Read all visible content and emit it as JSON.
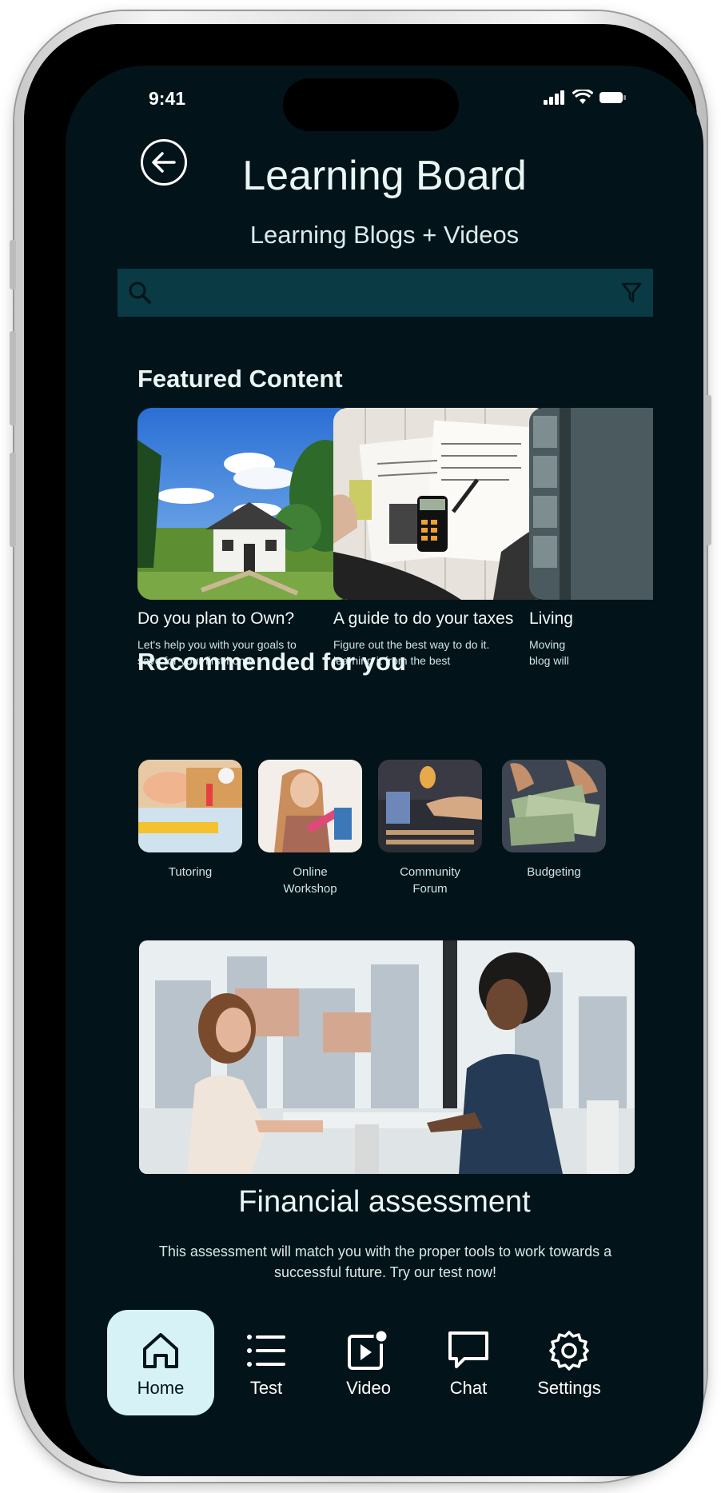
{
  "status": {
    "time": "9:41"
  },
  "header": {
    "title": "Learning Board",
    "subtitle": "Learning Blogs + Videos"
  },
  "search": {
    "placeholder": ""
  },
  "featured": {
    "section_title": "Featured Content",
    "items": [
      {
        "title": "Do you plan to Own?",
        "desc": "Let's help you with your goals to\nsave for your first home"
      },
      {
        "title": "A guide to do your taxes",
        "desc": "Figure out the best way to do it.\nlearning it from the best"
      },
      {
        "title": "Living",
        "desc": "Moving\nblog will"
      }
    ]
  },
  "recommended": {
    "section_title": "Recommended for you",
    "items": [
      {
        "label": "Tutoring"
      },
      {
        "label": "Online\nWorkshop"
      },
      {
        "label": "Community\nForum"
      },
      {
        "label": "Budgeting"
      }
    ]
  },
  "assessment": {
    "title": "Financial assessment",
    "desc": "This assessment will match you with the proper tools to work towards a successful future. Try our test now!"
  },
  "nav": {
    "items": [
      {
        "label": "Home",
        "icon": "home-icon"
      },
      {
        "label": "Test",
        "icon": "list-icon"
      },
      {
        "label": "Video",
        "icon": "video-icon"
      },
      {
        "label": "Chat",
        "icon": "chat-icon"
      },
      {
        "label": "Settings",
        "icon": "gear-icon"
      }
    ],
    "active": "Home"
  },
  "colors": {
    "background": "#021419",
    "search_bar": "#0a3a44",
    "nav_active": "#d6f2f7",
    "text": "#eaf6f6"
  }
}
